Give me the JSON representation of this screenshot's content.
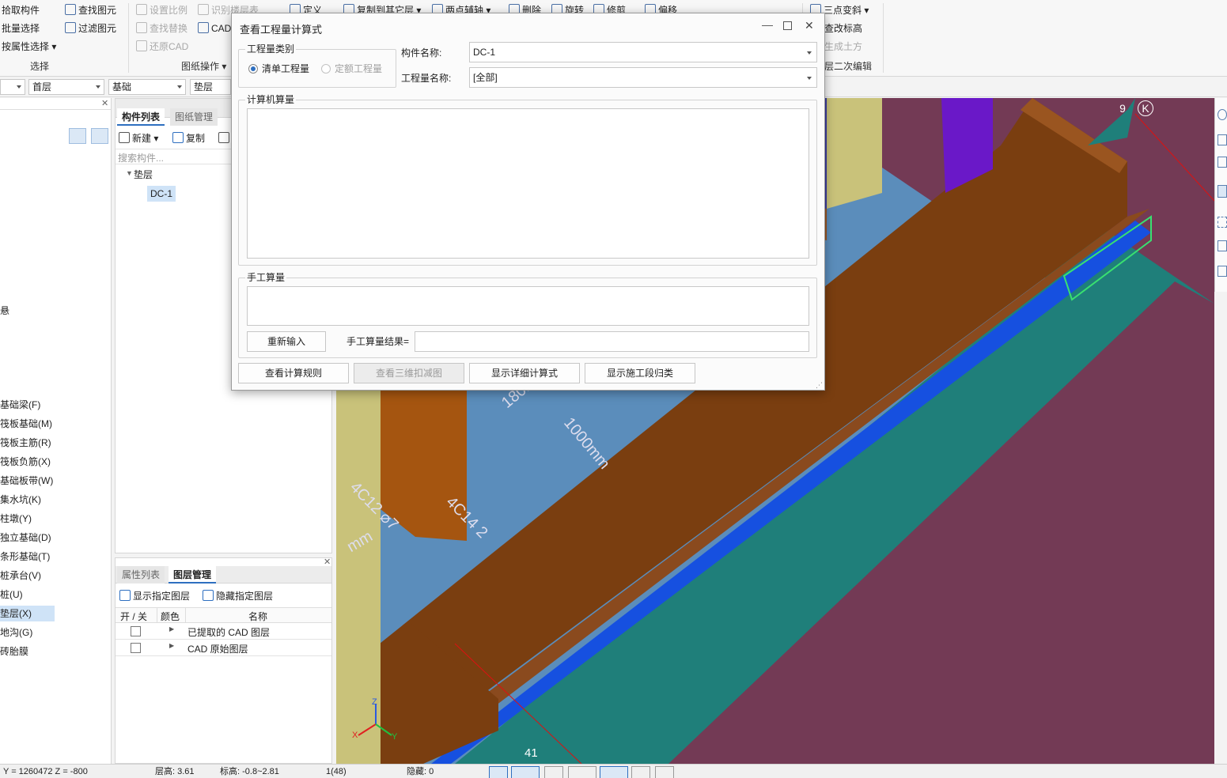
{
  "ribbon": {
    "select_group": {
      "pick_component": "拾取构件",
      "batch_select": "批量选择",
      "select_by_property": "按属性选择",
      "find_element": "查找图元",
      "filter_element": "过滤图元",
      "group_label": "选择"
    },
    "drawing_group": {
      "set_scale": "设置比例",
      "recognize_floor_table": "识别楼层表",
      "find_replace": "查找替换",
      "cad_label": "CAD",
      "restore_cad": "还原CAD",
      "group_label": "图纸操作"
    },
    "edit_group": {
      "define": "定义",
      "copy_to_other_floor": "复制到其它层",
      "two_point_axis": "两点辅轴",
      "delete": "删除",
      "rotate": "旋转",
      "trim": "修剪",
      "offset": "偏移"
    },
    "right_group": {
      "three_point_slope": "三点变斜",
      "check_elevation": "查改标高",
      "generate_earthwork": "生成土方",
      "floor_secondary_edit": "层二次编辑"
    }
  },
  "selectors": {
    "floor": "首层",
    "category": "基础",
    "type": "垫层"
  },
  "left_nav": {
    "items": [
      "基础梁(F)",
      "筏板基础(M)",
      "筏板主筋(R)",
      "筏板负筋(X)",
      "基础板带(W)",
      "集水坑(K)",
      "柱墩(Y)",
      "独立基础(D)",
      "条形基础(T)",
      "桩承台(V)",
      "桩(U)",
      "垫层(X)",
      "地沟(G)",
      "砖胎膜"
    ],
    "stray_char": "悬"
  },
  "component_panel": {
    "tab_list": "构件列表",
    "tab_drawing": "图纸管理",
    "new": "新建",
    "copy": "复制",
    "search_placeholder": "搜索构件...",
    "tree_root": "垫层",
    "tree_child": "DC-1"
  },
  "layer_panel": {
    "tab_props": "属性列表",
    "tab_layers": "图层管理",
    "show_layer": "显示指定图层",
    "hide_layer": "隐藏指定图层",
    "col_toggle": "开 / 关",
    "col_color": "颜色",
    "col_name": "名称",
    "rows": [
      {
        "name": "已提取的 CAD 图层"
      },
      {
        "name": "CAD 原始图层"
      }
    ]
  },
  "dialog": {
    "title": "查看工程量计算式",
    "qty_type_legend": "工程量类别",
    "radio_bill": "清单工程量",
    "radio_quota": "定额工程量",
    "component_name_label": "构件名称:",
    "component_name_value": "DC-1",
    "qty_name_label": "工程量名称:",
    "qty_name_value": "[全部]",
    "computer_legend": "计算机算量",
    "manual_legend": "手工算量",
    "reinput_button": "重新输入",
    "manual_result_label": "手工算量结果=",
    "btn_view_rules": "查看计算规则",
    "btn_view_3d": "查看三维扣减图",
    "btn_show_detail": "显示详细计算式",
    "btn_show_stage": "显示施工段归类"
  },
  "viewport": {
    "axis_9": "9",
    "axis_k": "K",
    "axis_41": "41",
    "dim1": "180mm",
    "dim2": "1000mm",
    "dim3": "4C14 2",
    "dim4": "4C12 ⌀7",
    "dim5": "mm",
    "axis_x": "X",
    "axis_y": "Y",
    "axis_z": "Z",
    "colors": {
      "background": "#733a55",
      "beam": "#7a3e10",
      "slab": "#5b8dbb",
      "teal": "#1f7f7a",
      "blue_strip": "#1650e0",
      "yellow_col": "#c9c27a",
      "purple_col": "#6a18c8"
    }
  },
  "statusbar": {
    "coords": "Y = 1260472 Z = -800",
    "floor_height": "层高:  3.61",
    "elevation": "标高:  -0.8~2.81",
    "count": "1(48)",
    "hidden": "隐藏:  0"
  }
}
